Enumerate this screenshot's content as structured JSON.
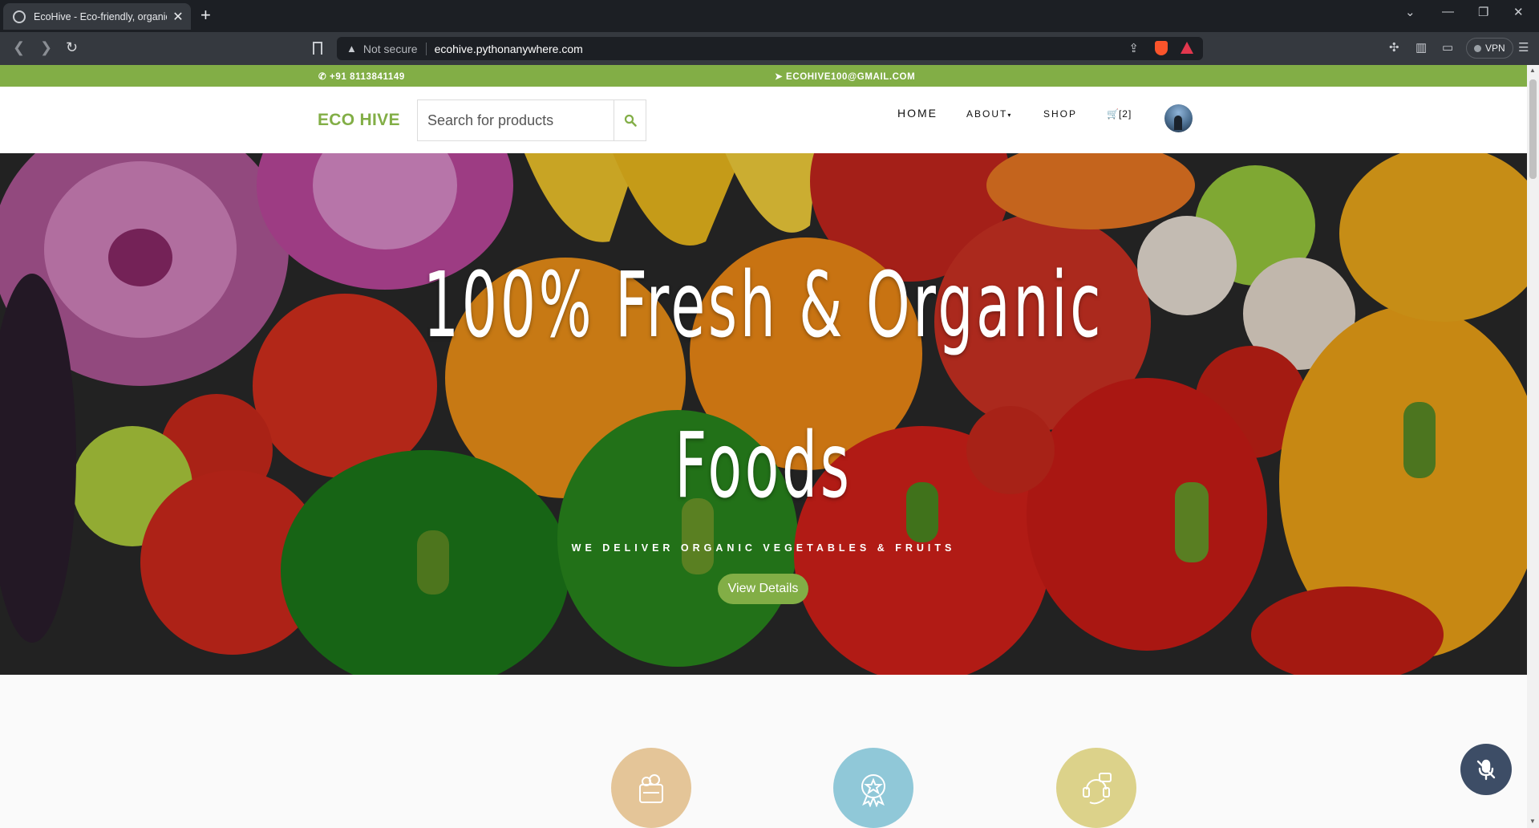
{
  "browser": {
    "tab_title": "EcoHive - Eco-friendly, organic",
    "url_security": "Not secure",
    "url": "ecohive.pythonanywhere.com",
    "vpn_label": "VPN"
  },
  "topbar": {
    "phone": "+91 8113841149",
    "email": "ECOHIVE100@GMAIL.COM"
  },
  "header": {
    "brand": "ECO HIVE",
    "search_placeholder": "Search for products",
    "menu": {
      "home": "HOME",
      "about": "ABOUT",
      "shop": "SHOP",
      "cart": "[2]"
    }
  },
  "hero": {
    "title_line1": "100% Fresh & Organic",
    "title_line2": "Foods",
    "subtitle": "WE DELIVER ORGANIC VEGETABLES & FRUITS",
    "button": "View Details"
  },
  "features": [
    {
      "icon": "grocery-bag-icon",
      "color": "#e4c598"
    },
    {
      "icon": "quality-badge-icon",
      "color": "#90c8d8"
    },
    {
      "icon": "customer-support-icon",
      "color": "#dcd28a"
    }
  ],
  "colors": {
    "accent": "#82ae46",
    "chrome_dark": "#1c1f24",
    "chrome_mid": "#35393f",
    "mic_button": "#3d4d66"
  }
}
